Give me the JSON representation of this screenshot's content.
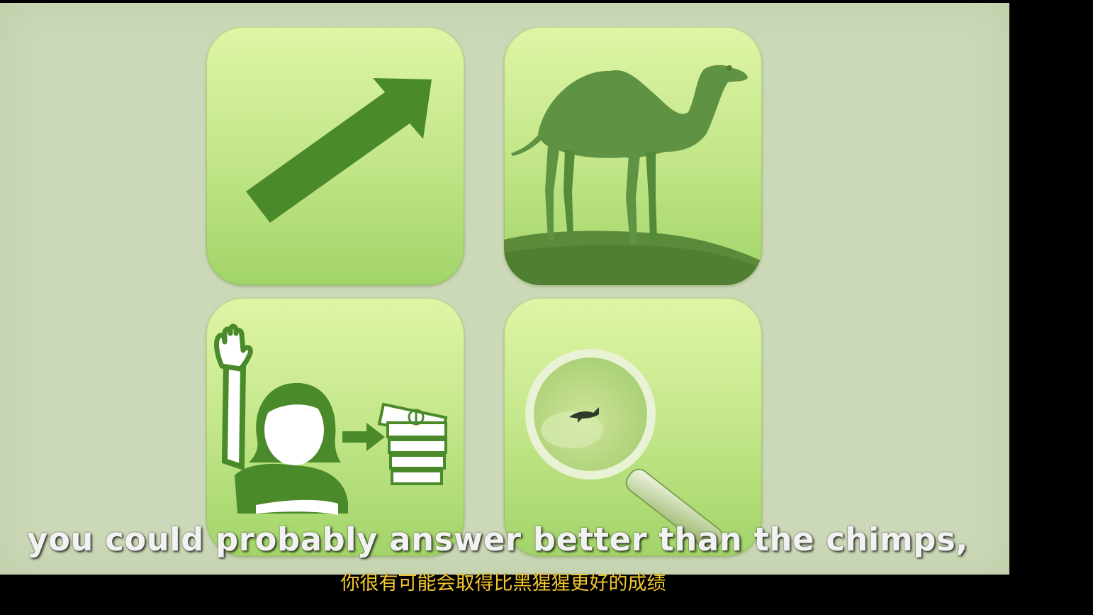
{
  "slide": {
    "tiles": [
      {
        "icon": "trend-arrow-icon"
      },
      {
        "icon": "camel-image"
      },
      {
        "icon": "person-raising-hand-to-money-icon"
      },
      {
        "icon": "magnifying-glass-shark-icon"
      }
    ],
    "colors": {
      "background": "#ccd9b8",
      "tile_top": "#dff5a6",
      "tile_bottom": "#a2d469",
      "icon_green": "#4a8a2a"
    }
  },
  "subtitles": {
    "english": "you could probably answer better than the chimps,",
    "chinese": "你很有可能会取得比黑猩猩更好的成绩",
    "english_color": "#f2f2f2",
    "chinese_color": "#f3c82e"
  }
}
